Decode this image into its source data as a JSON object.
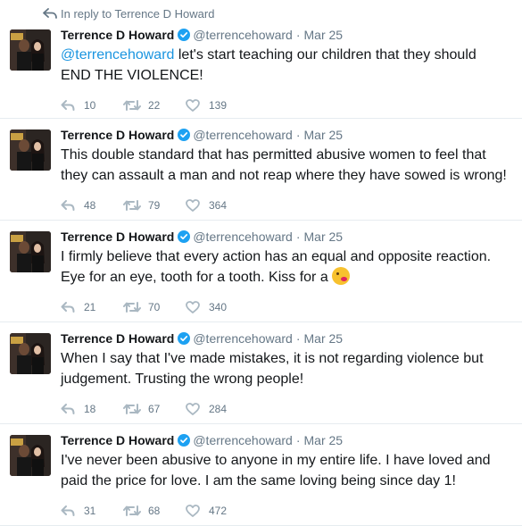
{
  "reply_header": "In reply to Terrence D Howard",
  "tweets": [
    {
      "name": "Terrence D Howard",
      "handle": "@terrencehoward",
      "date": "Mar 25",
      "mention": "@terrencehoward",
      "line1": " let's start teaching our children that they should",
      "line2": "END THE VIOLENCE!",
      "replies": "10",
      "retweets": "22",
      "likes": "139"
    },
    {
      "name": "Terrence D Howard",
      "handle": "@terrencehoward",
      "date": "Mar 25",
      "line1": "This double standard that has permitted abusive women to feel that",
      "line2": "they can assault a man and not reap where they have sowed is wrong!",
      "replies": "48",
      "retweets": "79",
      "likes": "364"
    },
    {
      "name": "Terrence D Howard",
      "handle": "@terrencehoward",
      "date": "Mar 25",
      "line1": "I firmly believe that every action has an equal and opposite reaction.",
      "line2": "Eye for an eye, tooth for a tooth.  Kiss for a",
      "emoji": "face-blowing-a-kiss",
      "replies": "21",
      "retweets": "70",
      "likes": "340"
    },
    {
      "name": "Terrence D Howard",
      "handle": "@terrencehoward",
      "date": "Mar 25",
      "line1": "When I say that I've made mistakes, it is not regarding violence but",
      "line2": "judgement.  Trusting the wrong people!",
      "replies": "18",
      "retweets": "67",
      "likes": "284"
    },
    {
      "name": "Terrence D Howard",
      "handle": "@terrencehoward",
      "date": "Mar 25",
      "line1": "I've never been abusive to anyone in my entire life. I have loved and",
      "line2": "paid the price for love. I am the same loving being since day 1!",
      "replies": "31",
      "retweets": "68",
      "likes": "472"
    }
  ],
  "icons": {
    "reply": "reply-icon",
    "retweet": "retweet-icon",
    "like": "heart-icon",
    "verified": "verified-badge-icon",
    "reply_header": "reply-arrow-icon"
  },
  "colors": {
    "link": "#1b95e0",
    "muted": "#657786",
    "text": "#14171a",
    "verified": "#1da1f2",
    "icon": "#aab8c2"
  }
}
